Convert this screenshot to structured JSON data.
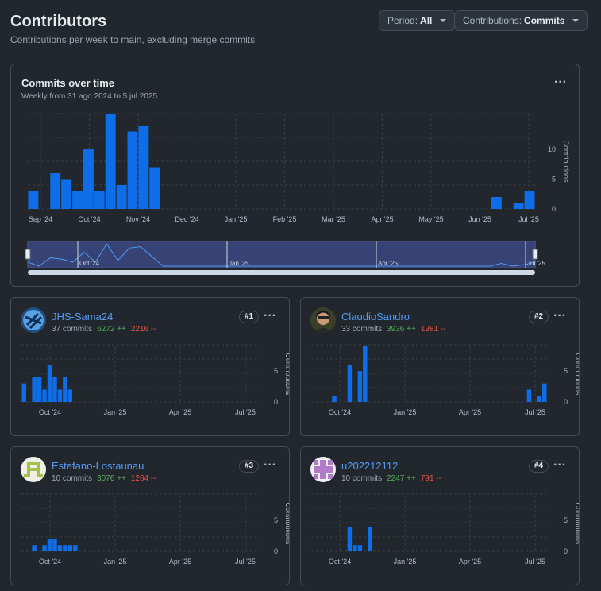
{
  "header": {
    "title": "Contributors",
    "subtitle": "Contributions per week to main, excluding merge commits",
    "period_prefix": "Period:",
    "period_value": "All",
    "contrib_prefix": "Contributions:",
    "contrib_value": "Commits"
  },
  "overview": {
    "title": "Commits over time",
    "subtitle": "Weekly from 31 ago 2024 to 5 jul 2025",
    "range_labels": [
      "Oct '24",
      "Jan '25",
      "Apr '25",
      "Jul '25"
    ]
  },
  "chart_data": [
    {
      "type": "bar",
      "title": "Commits over time",
      "ylabel": "Contributions",
      "yticks": [
        0,
        5,
        10
      ],
      "xticks": [
        "Sep '24",
        "Oct '24",
        "Nov '24",
        "Dec '24",
        "Jan '25",
        "Feb '25",
        "Mar '25",
        "Apr '25",
        "May '25",
        "Jun '25",
        "Jul '25"
      ],
      "ylim": [
        0,
        16
      ],
      "series": [
        {
          "values": [
            3,
            0,
            6,
            5,
            3,
            10,
            3,
            16,
            4,
            13,
            14,
            7,
            0,
            0,
            0,
            0,
            0,
            0,
            0,
            0,
            0,
            0,
            0,
            0,
            0,
            0,
            0,
            0,
            0,
            0,
            0,
            0,
            0,
            0,
            0,
            0,
            0,
            0,
            0,
            0,
            0,
            0,
            2,
            0,
            1,
            3
          ]
        }
      ],
      "grid": true
    },
    {
      "type": "bar",
      "title": "JHS-Sama24",
      "ylabel": "Contributions",
      "yticks": [
        0,
        5
      ],
      "xticks": [
        "Oct '24",
        "Jan '25",
        "Apr '25",
        "Jul '25"
      ],
      "ylim": [
        0,
        9
      ],
      "series": [
        {
          "values": [
            3,
            0,
            4,
            4,
            2,
            6,
            4,
            2,
            4,
            2,
            0,
            0,
            0,
            0,
            0,
            0,
            0,
            0,
            0,
            0,
            0,
            0,
            0,
            0,
            0,
            0,
            0,
            0,
            0,
            0,
            0,
            0,
            0,
            0,
            0,
            0,
            0,
            0,
            0,
            0,
            0,
            0,
            0,
            0,
            0,
            0
          ]
        }
      ],
      "grid": true
    },
    {
      "type": "bar",
      "title": "ClaudioSandro",
      "ylabel": "Contributions",
      "yticks": [
        0,
        5
      ],
      "xticks": [
        "Oct '24",
        "Jan '25",
        "Apr '25",
        "Jul '25"
      ],
      "ylim": [
        0,
        9
      ],
      "series": [
        {
          "values": [
            0,
            0,
            0,
            0,
            1,
            0,
            0,
            6,
            0,
            5,
            9,
            0,
            0,
            0,
            0,
            0,
            0,
            0,
            0,
            0,
            0,
            0,
            0,
            0,
            0,
            0,
            0,
            0,
            0,
            0,
            0,
            0,
            0,
            0,
            0,
            0,
            0,
            0,
            0,
            0,
            0,
            0,
            2,
            0,
            1,
            3
          ]
        }
      ],
      "grid": true
    },
    {
      "type": "bar",
      "title": "Estefano-Lostaunau",
      "ylabel": "Contributions",
      "yticks": [
        0,
        5
      ],
      "xticks": [
        "Oct '24",
        "Jan '25",
        "Apr '25",
        "Jul '25"
      ],
      "ylim": [
        0,
        9
      ],
      "series": [
        {
          "values": [
            0,
            0,
            1,
            0,
            1,
            2,
            2,
            1,
            1,
            1,
            1,
            0,
            0,
            0,
            0,
            0,
            0,
            0,
            0,
            0,
            0,
            0,
            0,
            0,
            0,
            0,
            0,
            0,
            0,
            0,
            0,
            0,
            0,
            0,
            0,
            0,
            0,
            0,
            0,
            0,
            0,
            0,
            0,
            0,
            0,
            0
          ]
        }
      ],
      "grid": true
    },
    {
      "type": "bar",
      "title": "u202212112",
      "ylabel": "Contributions",
      "yticks": [
        0,
        5
      ],
      "xticks": [
        "Oct '24",
        "Jan '25",
        "Apr '25",
        "Jul '25"
      ],
      "ylim": [
        0,
        9
      ],
      "series": [
        {
          "values": [
            0,
            0,
            0,
            0,
            0,
            0,
            0,
            4,
            1,
            1,
            0,
            4,
            0,
            0,
            0,
            0,
            0,
            0,
            0,
            0,
            0,
            0,
            0,
            0,
            0,
            0,
            0,
            0,
            0,
            0,
            0,
            0,
            0,
            0,
            0,
            0,
            0,
            0,
            0,
            0,
            0,
            0,
            0,
            0,
            0,
            0
          ]
        }
      ],
      "grid": true
    }
  ],
  "contributors": [
    {
      "name": "JHS-Sama24",
      "commits": "37 commits",
      "add": "6272 ++",
      "del": "2216 --",
      "rank": "#1"
    },
    {
      "name": "ClaudioSandro",
      "commits": "33 commits",
      "add": "3936 ++",
      "del": "1981 --",
      "rank": "#2"
    },
    {
      "name": "Estefano-Lostaunau",
      "commits": "10 commits",
      "add": "3076 ++",
      "del": "1264 --",
      "rank": "#3"
    },
    {
      "name": "u202212112",
      "commits": "10 commits",
      "add": "2247 ++",
      "del": "791 --",
      "rank": "#4"
    }
  ],
  "colors": {
    "bar": "#0e6de8",
    "accent": "#539bf5",
    "add": "#57ab5a",
    "del": "#e5534b"
  }
}
